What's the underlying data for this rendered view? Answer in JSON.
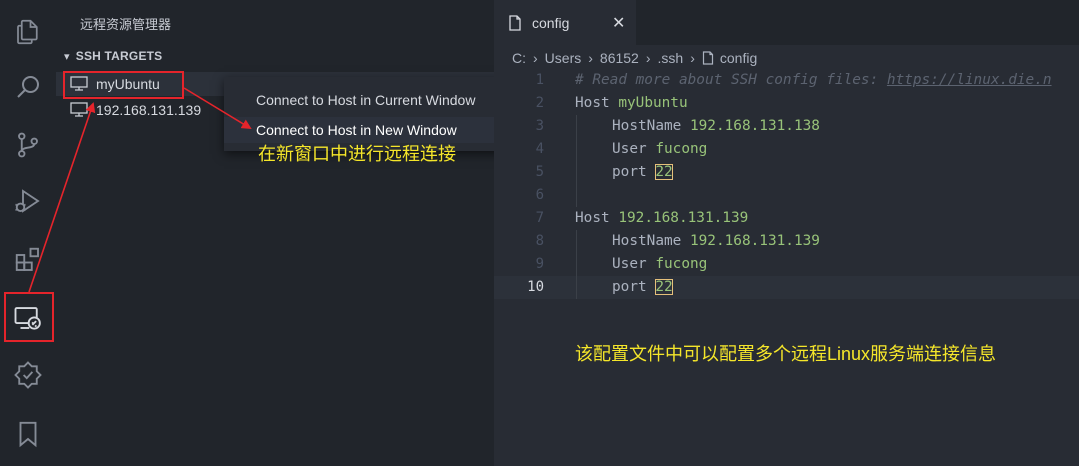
{
  "colors": {
    "accent_red": "#e5242b",
    "annotation_yellow": "#f5e62a",
    "string_green": "#98c379"
  },
  "activity_bar": {
    "icons": [
      "explorer-icon",
      "search-icon",
      "source-control-icon",
      "run-debug-icon",
      "extensions-icon",
      "remote-explorer-icon",
      "testing-icon",
      "bookmarks-icon"
    ]
  },
  "sidebar": {
    "title": "远程资源管理器",
    "section": "SSH TARGETS",
    "hosts": [
      {
        "label": "myUbuntu"
      },
      {
        "label": "192.168.131.139"
      }
    ]
  },
  "context_menu": {
    "items": [
      {
        "label": "Connect to Host in Current Window"
      },
      {
        "label": "Connect to Host in New Window"
      }
    ]
  },
  "annotations": {
    "context_note": "在新窗口中进行远程连接",
    "config_note": "该配置文件中可以配置多个远程Linux服务端连接信息"
  },
  "editor": {
    "tab_label": "config",
    "tab_close": "✕",
    "breadcrumb": [
      "C:",
      "Users",
      "86152",
      ".ssh",
      "config"
    ],
    "line_numbers": [
      "1",
      "2",
      "3",
      "4",
      "5",
      "6",
      "7",
      "8",
      "9",
      "10"
    ],
    "comment": "# Read more about SSH config files: https://linux.die.n",
    "comment_prefix": "# Read more about SSH config files: ",
    "comment_link": "https://linux.die.n",
    "lines": [
      {
        "key": "Host",
        "value": "myUbuntu"
      },
      {
        "key": "HostName",
        "value": "192.168.131.138"
      },
      {
        "key": "User",
        "value": "fucong"
      },
      {
        "key": "port",
        "value": "22"
      },
      {
        "key": "Host",
        "value": "192.168.131.139"
      },
      {
        "key": "HostName",
        "value": "192.168.131.139"
      },
      {
        "key": "User",
        "value": "fucong"
      },
      {
        "key": "port",
        "value": "22"
      }
    ]
  }
}
